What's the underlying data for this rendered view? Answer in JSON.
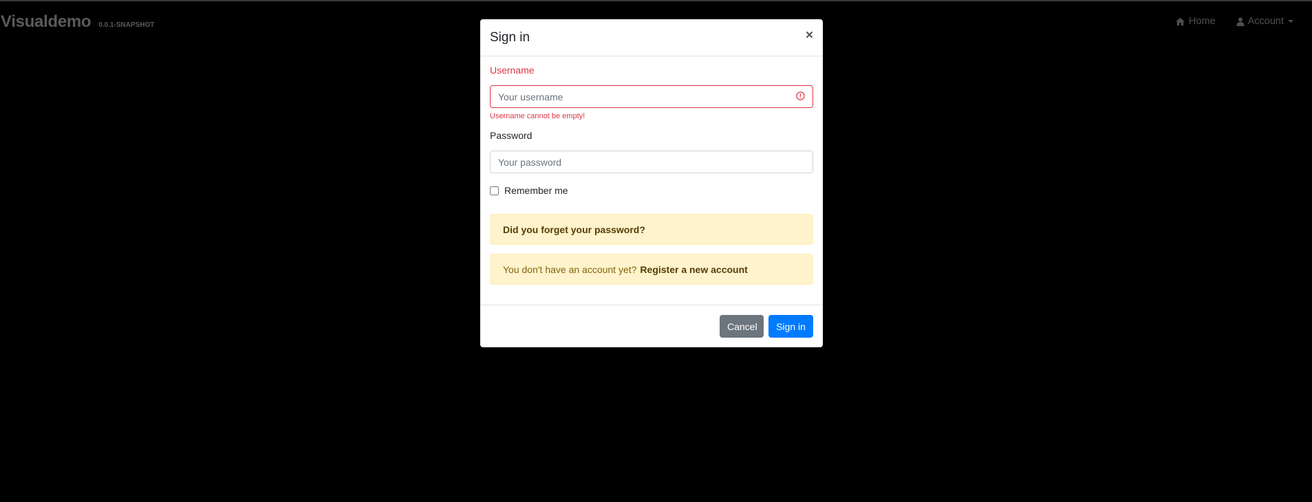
{
  "app": {
    "title": "Visualdemo",
    "version": "0.0.1-SNAPSHOT"
  },
  "nav": {
    "home_label": "Home",
    "home_icon": "home-icon",
    "account_label": "Account",
    "account_icon": "user-icon"
  },
  "modal": {
    "title": "Sign in",
    "close_glyph": "×",
    "username": {
      "label": "Username",
      "placeholder": "Your username",
      "value": "",
      "error": "Username cannot be empty!"
    },
    "password": {
      "label": "Password",
      "placeholder": "Your password",
      "value": ""
    },
    "remember_label": "Remember me",
    "remember_checked": false,
    "forgot_link": "Did you forget your password?",
    "register_prefix": "You don't have an account yet?",
    "register_link": "Register a new account",
    "cancel_label": "Cancel",
    "signin_label": "Sign in"
  },
  "colors": {
    "backdrop": "#000000",
    "error": "#dc3545",
    "primary": "#007bff",
    "secondary": "#6c757d",
    "warning_bg": "#fff3cd"
  }
}
